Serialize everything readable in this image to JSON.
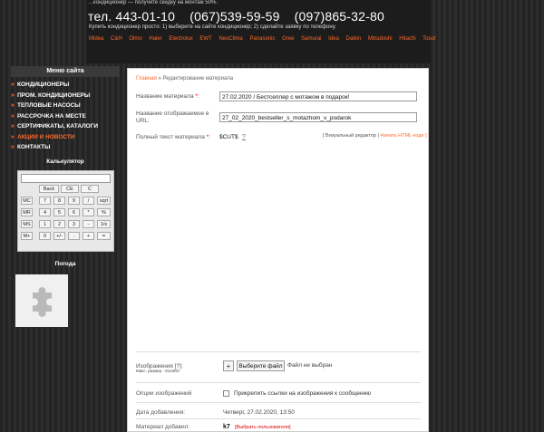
{
  "header": {
    "promo_line1": "...кондиционер — получите скидку на монтаж 50%.",
    "phones": [
      "тел. 443-01-10",
      "(067)539-59-59",
      "(097)865-32-80"
    ],
    "buy_hint": "Купить кондиционер просто: 1) выберите на сайте кондиционер; 2) сделайте заявку по телефону.",
    "brands": [
      "Midea",
      "C&H",
      "Olmo",
      "Haier",
      "Electrolux",
      "EWT",
      "NeoClima",
      "Panasonic",
      "Gree",
      "Samurai",
      "Idea",
      "Daikin",
      "Mitsubishi",
      "Hitachi",
      "Tosot"
    ]
  },
  "sidebar": {
    "menu_title": "Меню сайта",
    "items": [
      {
        "label": "КОНДИЦИОНЕРЫ",
        "active": false
      },
      {
        "label": "ПРОМ. КОНДИЦИОНЕРЫ",
        "active": false
      },
      {
        "label": "ТЕПЛОВЫЕ НАСОСЫ",
        "active": false
      },
      {
        "label": "РАССРОЧКА НА МЕСТЕ",
        "active": false
      },
      {
        "label": "СЕРТИФИКАТЫ, КАТАЛОГИ",
        "active": false
      },
      {
        "label": "АКЦИИ И НОВОСТИ",
        "active": true
      },
      {
        "label": "КОНТАКТЫ",
        "active": false
      }
    ],
    "calc_title": "Калькулятор",
    "calc_rows": [
      [
        "Back",
        "CE",
        "C"
      ],
      [
        "MC",
        "7",
        "8",
        "9",
        "/",
        "sqrt"
      ],
      [
        "MR",
        "4",
        "5",
        "6",
        "*",
        "%"
      ],
      [
        "MS",
        "1",
        "2",
        "3",
        "-",
        "1/x"
      ],
      [
        "M+",
        "0",
        "+/-",
        ".",
        "+",
        "="
      ]
    ],
    "weather_title": "Погода",
    "weather_icon": "puzzle-icon"
  },
  "main": {
    "breadcrumb_home": "Главная",
    "breadcrumb_sep": "»",
    "breadcrumb_current": "Редактирование материала",
    "title_label": "Название материала",
    "title_value": "27.02.2020 / Бестселлер с мотажом в подарок!",
    "url_label": "Название отображаемое в URL:",
    "url_value": "27_02_2020_bestseller_s_motazhom_v_podarok",
    "fulltext_label": "Полный текст материала",
    "fulltext_value": "$CUT$",
    "help_mark": "?",
    "visual_editor": "[ Визуальный редактор",
    "plain_html": "Начать HTML-коде ]",
    "images_label": "Изображения [?]:",
    "images_note": "Макс. размер - 6144Kb",
    "plus_label": "+",
    "choose_file": "Выберите файл",
    "file_status": "Файл не выбран",
    "image_options_label": "Опции изображений",
    "attach_links_label": "Прикрепить ссылки на изображения к сообщению",
    "date_label": "Дата добавления:",
    "date_value": "Четверг, 27.02.2020, 13:50",
    "author_label": "Материал добавил:",
    "author_value": "k7",
    "author_link": "[Выбрать пользователя]"
  }
}
